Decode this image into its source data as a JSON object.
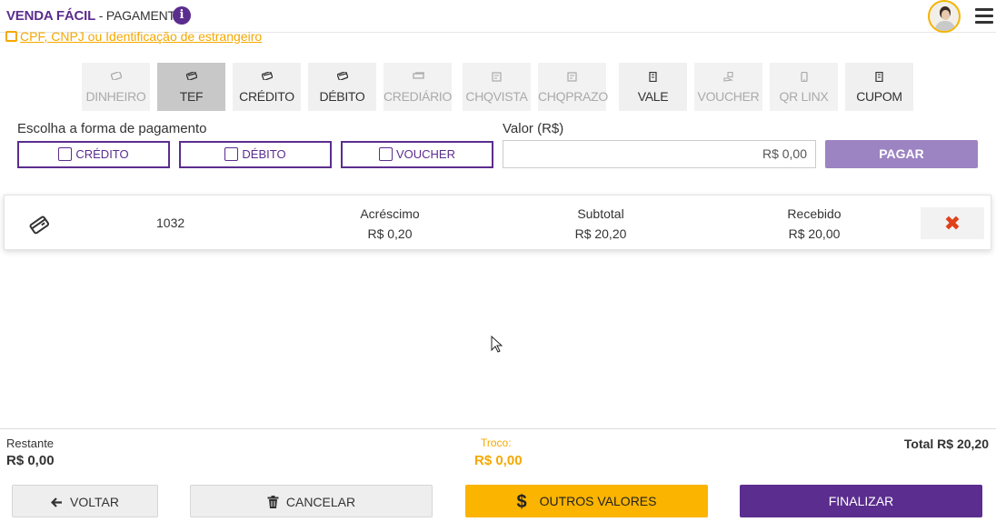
{
  "header": {
    "brand": "VENDA FÁCIL",
    "separator": " - ",
    "section": "PAGAMENTO",
    "info_icon": "i"
  },
  "cpf_link": "CPF, CNPJ ou Identificação de estrangeiro",
  "tabs": [
    {
      "label": "DINHEIRO",
      "icon": "money-icon",
      "state": "disabled"
    },
    {
      "label": "TEF",
      "icon": "card-icon",
      "state": "active"
    },
    {
      "label": "CRÉDITO",
      "icon": "card-icon",
      "state": "enabled"
    },
    {
      "label": "DÉBITO",
      "icon": "card-icon",
      "state": "enabled"
    },
    {
      "label": "CREDIÁRIO",
      "icon": "bills-icon",
      "state": "disabled"
    },
    {
      "label": "CHQVISTA",
      "icon": "check-icon",
      "state": "disabled"
    },
    {
      "label": "CHQPRAZO",
      "icon": "check-icon",
      "state": "disabled"
    },
    {
      "label": "VALE",
      "icon": "receipt-icon",
      "state": "enabled"
    },
    {
      "label": "VOUCHER",
      "icon": "hand-icon",
      "state": "disabled"
    },
    {
      "label": "QR LINX",
      "icon": "phone-icon",
      "state": "disabled"
    },
    {
      "label": "CUPOM",
      "icon": "coupon-icon",
      "state": "enabled"
    }
  ],
  "choose": {
    "label": "Escolha a forma de pagamento",
    "options": [
      "CRÉDITO",
      "DÉBITO",
      "VOUCHER"
    ]
  },
  "valor": {
    "label": "Valor (R$)",
    "value": "R$ 0,00",
    "button": "PAGAR"
  },
  "payment": {
    "icon": "card-icon",
    "code": "1032",
    "acrescimo_label": "Acréscimo",
    "acrescimo_value": "R$ 0,20",
    "subtotal_label": "Subtotal",
    "subtotal_value": "R$ 20,20",
    "recebido_label": "Recebido",
    "recebido_value": "R$ 20,00",
    "delete_icon": "✖"
  },
  "totals": {
    "restante_label": "Restante",
    "restante_value": "R$ 0,00",
    "troco_label": "Troco:",
    "troco_value": "R$ 0,00",
    "total": "Total R$ 20,20"
  },
  "buttons": {
    "voltar": "VOLTAR",
    "cancelar": "CANCELAR",
    "outros": "OUTROS VALORES",
    "finalizar": "FINALIZAR"
  },
  "colors": {
    "brand": "#5b2d8e",
    "accent": "#f5a800",
    "danger": "#e0401a"
  }
}
